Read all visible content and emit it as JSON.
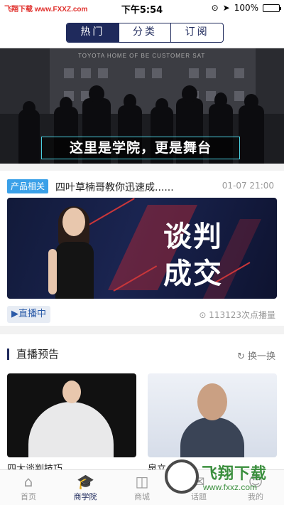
{
  "status_bar": {
    "watermark": "飞翔下载 www.FXXZ.com",
    "time": "下午5:54",
    "battery": "100%",
    "battery_level": 1.0
  },
  "header": {
    "tabs": [
      {
        "label": "热门",
        "active": true
      },
      {
        "label": "分类",
        "active": false
      },
      {
        "label": "订阅",
        "active": false
      }
    ]
  },
  "banner": {
    "slogan": "这里是学院，更是舞台",
    "sign_text": "TOYOTA HOME OF BE CUSTOMER SAT"
  },
  "article": {
    "badge": "产品相关",
    "title": "四叶草楠哥教你迅速成......",
    "date": "01-07 21:00",
    "image_text_line1": "谈判",
    "image_text_line2": "成交",
    "live_label": "▶直播中",
    "plays": "⊙ 113123次点播量"
  },
  "preview": {
    "title": "直播预告",
    "refresh": "换一换",
    "cards": [
      {
        "caption": "四大谈判技巧"
      },
      {
        "caption": "泉立"
      }
    ]
  },
  "tabbar": {
    "items": [
      {
        "label": "首页",
        "icon": "home-icon",
        "active": false
      },
      {
        "label": "商学院",
        "icon": "graduation-cap-icon",
        "active": true
      },
      {
        "label": "商城",
        "icon": "shopping-bag-icon",
        "active": false
      },
      {
        "label": "话题",
        "icon": "chat-icon",
        "active": false
      },
      {
        "label": "我的",
        "icon": "user-icon",
        "active": false
      }
    ]
  },
  "watermark": {
    "brand": "飞翔下载",
    "url": "www.fxxz.com"
  },
  "colors": {
    "primary": "#1f2a5c",
    "badge": "#3aa0e8",
    "watermark_green": "#3b8f3e"
  }
}
